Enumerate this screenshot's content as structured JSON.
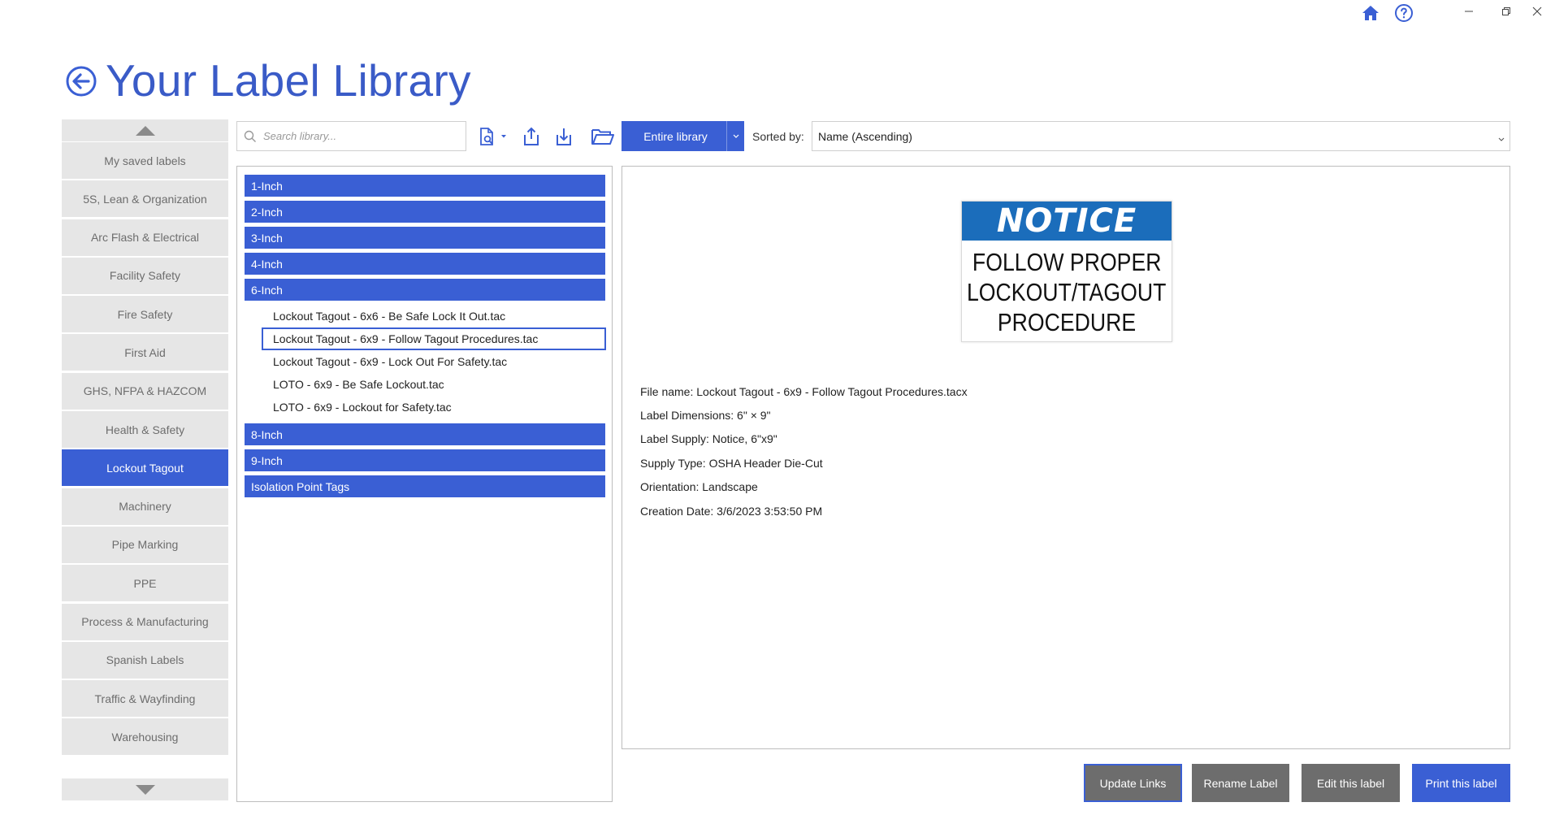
{
  "window": {
    "minimize_glyph": "—",
    "restore_glyph": "❐",
    "close_glyph": "✕"
  },
  "icons": {
    "home": "home-icon",
    "help": "help-icon",
    "back": "back-arrow-icon",
    "search": "search-icon",
    "library_search": "document-search-icon",
    "export": "export-icon",
    "import": "import-icon",
    "folder": "folder-open-icon"
  },
  "colors": {
    "accent": "#3a5fd4",
    "title": "#3a5bc7",
    "sidebar_bg": "#e6e6e6",
    "button_gray": "#6d6d6d",
    "notice_blue": "#1b6dbb"
  },
  "header": {
    "title": "Your Label Library"
  },
  "sidebar": {
    "items": [
      {
        "label": "My saved labels",
        "active": false
      },
      {
        "label": "5S, Lean & Organization",
        "active": false
      },
      {
        "label": "Arc Flash & Electrical",
        "active": false
      },
      {
        "label": "Facility Safety",
        "active": false
      },
      {
        "label": "Fire Safety",
        "active": false
      },
      {
        "label": "First Aid",
        "active": false
      },
      {
        "label": "GHS, NFPA & HAZCOM",
        "active": false
      },
      {
        "label": "Health & Safety",
        "active": false
      },
      {
        "label": "Lockout Tagout",
        "active": true
      },
      {
        "label": "Machinery",
        "active": false
      },
      {
        "label": "Pipe Marking",
        "active": false
      },
      {
        "label": "PPE",
        "active": false
      },
      {
        "label": "Process & Manufacturing",
        "active": false
      },
      {
        "label": "Spanish Labels",
        "active": false
      },
      {
        "label": "Traffic & Wayfinding",
        "active": false
      },
      {
        "label": "Warehousing",
        "active": false
      }
    ]
  },
  "toolbar": {
    "search_placeholder": "Search library...",
    "scope_label": "Entire library",
    "sorted_by_label": "Sorted by:",
    "sort_value": "Name (Ascending)"
  },
  "tree": {
    "groups": [
      {
        "label": "1-Inch",
        "files": []
      },
      {
        "label": "2-Inch",
        "files": []
      },
      {
        "label": "3-Inch",
        "files": []
      },
      {
        "label": "4-Inch",
        "files": []
      },
      {
        "label": "6-Inch",
        "files": [
          {
            "name": "Lockout Tagout - 6x6 - Be Safe Lock It Out.tac",
            "selected": false
          },
          {
            "name": "Lockout Tagout - 6x9 - Follow Tagout Procedures.tac",
            "selected": true
          },
          {
            "name": "Lockout Tagout - 6x9 - Lock Out For Safety.tac",
            "selected": false
          },
          {
            "name": "LOTO - 6x9 - Be Safe Lockout.tac",
            "selected": false
          },
          {
            "name": "LOTO - 6x9 - Lockout for Safety.tac",
            "selected": false
          }
        ]
      },
      {
        "label": "8-Inch",
        "files": []
      },
      {
        "label": "9-Inch",
        "files": []
      },
      {
        "label": "Isolation Point Tags",
        "files": []
      }
    ]
  },
  "preview": {
    "header_text": "NOTICE",
    "body_lines": [
      "FOLLOW PROPER",
      "LOCKOUT/TAGOUT",
      "PROCEDURE"
    ],
    "details": [
      "File name: Lockout Tagout - 6x9 - Follow Tagout Procedures.tacx",
      "Label Dimensions: 6\" × 9\"",
      "Label Supply: Notice, 6\"x9\"",
      "Supply Type: OSHA Header Die-Cut",
      "Orientation: Landscape",
      "Creation Date: 3/6/2023 3:53:50 PM"
    ]
  },
  "actions": {
    "update_links": "Update Links",
    "rename_label": "Rename Label",
    "edit_label": "Edit this label",
    "print_label": "Print this label"
  }
}
